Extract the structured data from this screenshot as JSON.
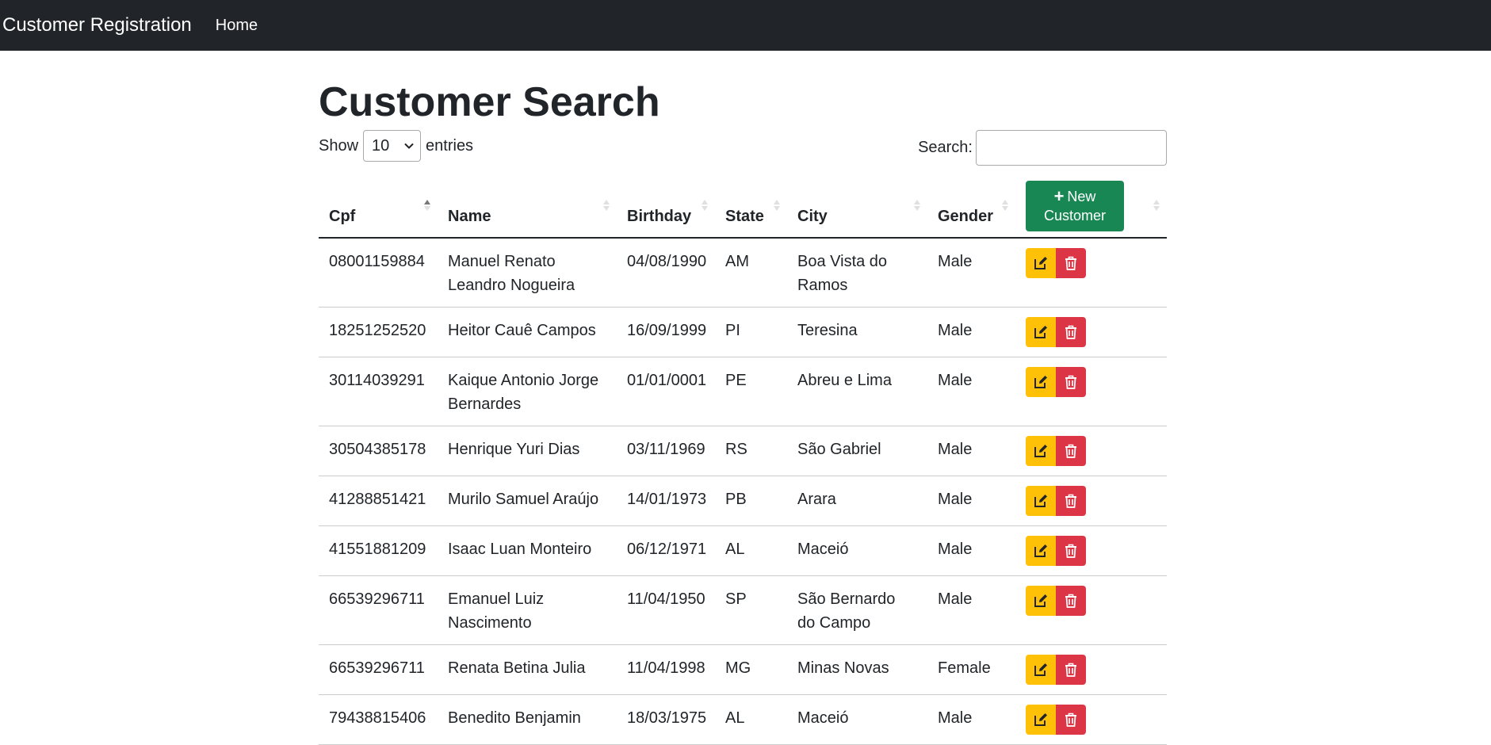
{
  "navbar": {
    "brand": "Customer Registration",
    "links": [
      "Home"
    ]
  },
  "page": {
    "title": "Customer Search"
  },
  "length_control": {
    "show_label": "Show",
    "selected": "10",
    "entries_label": "entries"
  },
  "search": {
    "label": "Search:",
    "value": ""
  },
  "table": {
    "columns": [
      "Cpf",
      "Name",
      "Birthday",
      "State",
      "City",
      "Gender"
    ],
    "new_button_icon": "+",
    "new_button_line1": "New",
    "new_button_line2": "Customer",
    "rows": [
      [
        "08001159884",
        "Manuel Renato Leandro Nogueira",
        "04/08/1990",
        "AM",
        "Boa Vista do Ramos",
        "Male"
      ],
      [
        "18251252520",
        "Heitor Cauê Campos",
        "16/09/1999",
        "PI",
        "Teresina",
        "Male"
      ],
      [
        "30114039291",
        "Kaique Antonio Jorge Bernardes",
        "01/01/0001",
        "PE",
        "Abreu e Lima",
        "Male"
      ],
      [
        "30504385178",
        "Henrique Yuri Dias",
        "03/11/1969",
        "RS",
        "São Gabriel",
        "Male"
      ],
      [
        "41288851421",
        "Murilo Samuel Araújo",
        "14/01/1973",
        "PB",
        "Arara",
        "Male"
      ],
      [
        "41551881209",
        "Isaac Luan Monteiro",
        "06/12/1971",
        "AL",
        "Maceió",
        "Male"
      ],
      [
        "66539296711",
        "Emanuel Luiz Nascimento",
        "11/04/1950",
        "SP",
        "São Bernardo do Campo",
        "Male"
      ],
      [
        "66539296711",
        "Renata Betina Julia",
        "11/04/1998",
        "MG",
        "Minas Novas",
        "Female"
      ],
      [
        "79438815406",
        "Benedito Benjamin",
        "18/03/1975",
        "AL",
        "Maceió",
        "Male"
      ]
    ]
  },
  "icons": {
    "edit": "edit-icon",
    "delete": "trash-icon",
    "sort": "sort-icon",
    "chevron": "chevron-down-icon"
  },
  "colors": {
    "navbar": "#212529",
    "new_button": "#198754",
    "edit_button": "#ffc107",
    "delete_button": "#dc3545"
  }
}
